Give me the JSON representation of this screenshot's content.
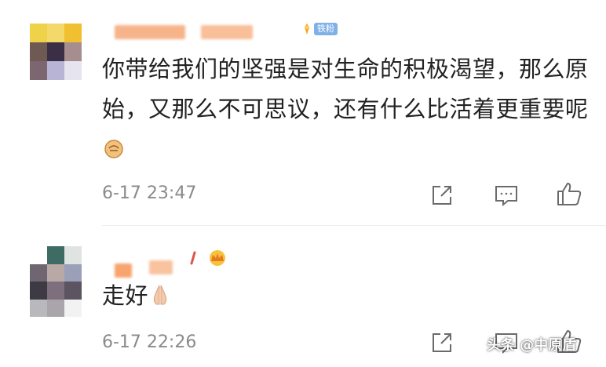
{
  "comments": [
    {
      "badge_label": "铁粉",
      "text": "你带给我们的坚强是对生命的积极渴望，那么原始，又那么不可思议，还有什么比活着更重要呢",
      "emoji": "fist-emoji",
      "time": "6-17 23:47"
    },
    {
      "badge_icon": "crown-icon",
      "text": "走好",
      "emoji": "praying-hands-emoji",
      "time": "6-17 22:26"
    }
  ],
  "actions": {
    "share_icon": "share-icon",
    "comment_icon": "comment-icon",
    "like_icon": "thumbs-up-icon"
  },
  "watermark": "头条 @中原盾",
  "colors": {
    "text": "#222222",
    "meta": "#8a8a8a",
    "icon": "#6b6b6b",
    "badge": "#7fb0e8",
    "name_blur": "#f7b48a"
  }
}
